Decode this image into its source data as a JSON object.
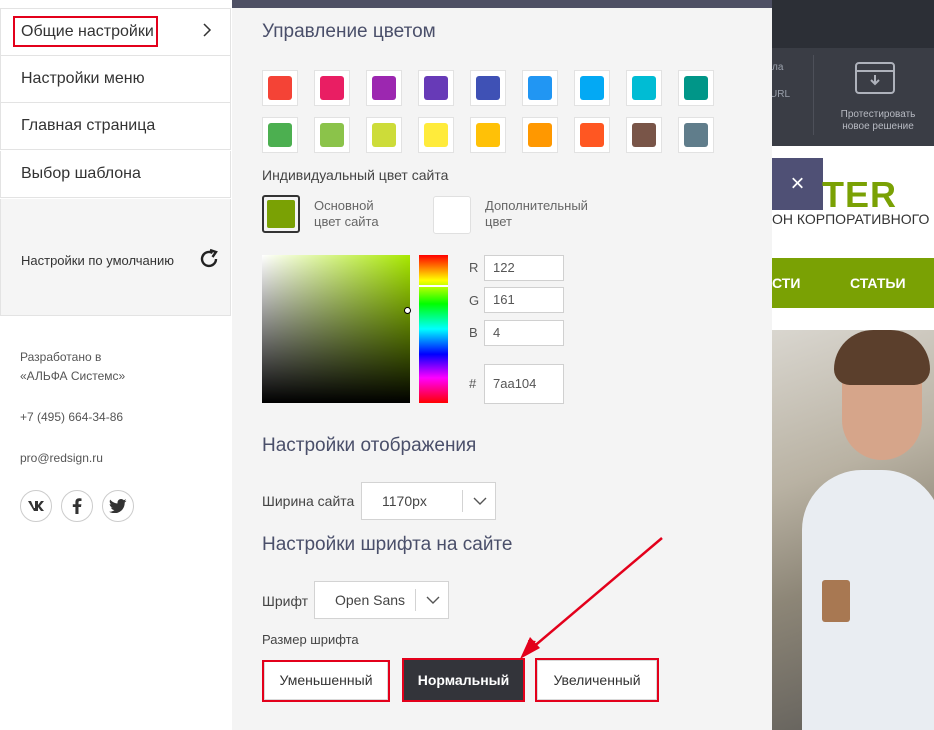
{
  "menu": {
    "items": [
      {
        "label": "Общие настройки"
      },
      {
        "label": "Настройки меню"
      },
      {
        "label": "Главная страница"
      },
      {
        "label": "Выбор шаблона"
      }
    ],
    "reset_label": "Настройки по умолчанию"
  },
  "footer": {
    "developed_line1": "Разработано в",
    "developed_line2": "«АЛЬФА Системс»",
    "phone": "+7 (495) 664-34-86",
    "email": "pro@redsign.ru",
    "social": [
      "vk-icon",
      "facebook-icon",
      "twitter-icon"
    ]
  },
  "color_section": {
    "title": "Управление цветом",
    "swatches_row1": [
      "#f44336",
      "#e91e63",
      "#9c27b0",
      "#673ab7",
      "#3f51b5",
      "#2196f3",
      "#03a9f4",
      "#00bcd4",
      "#009688"
    ],
    "swatches_row2": [
      "#4caf50",
      "#8bc34a",
      "#cddc39",
      "#ffeb3b",
      "#ffc107",
      "#ff9800",
      "#ff5722",
      "#795548",
      "#607d8b"
    ],
    "custom_title": "Индивидуальный цвет сайта",
    "primary_label_1": "Основной",
    "primary_label_2": "цвет сайта",
    "primary_color": "#7aa104",
    "secondary_label_1": "Дополнительный",
    "secondary_label_2": "цвет",
    "secondary_color": "#ffffff",
    "r_label": "R",
    "r": "122",
    "g_label": "G",
    "g": "161",
    "b_label": "B",
    "b": "4",
    "hex_label": "#",
    "hex": "7aa104"
  },
  "display_section": {
    "title": "Настройки отображения",
    "width_label": "Ширина сайта",
    "width_value": "1170px"
  },
  "font_section": {
    "title": "Настройки шрифта на сайте",
    "font_label": "Шрифт",
    "font_value": "Open Sans",
    "size_label": "Размер шрифта",
    "size_small": "Уменьшенный",
    "size_normal": "Нормальный",
    "size_large": "Увеличенный"
  },
  "site_preview": {
    "top_text_1": "ла",
    "top_text_2": "URL",
    "test_line1": "Протестировать",
    "test_line2": "новое решение",
    "close": "×",
    "brand": "TER",
    "brand_sub": "ОН КОРПОРАТИВНОГО",
    "nav_1": "СТИ",
    "nav_2": "СТАТЬИ"
  },
  "colors": {
    "accent": "#7aa104",
    "highlight": "#e3001b",
    "dark_button": "#33343a"
  }
}
